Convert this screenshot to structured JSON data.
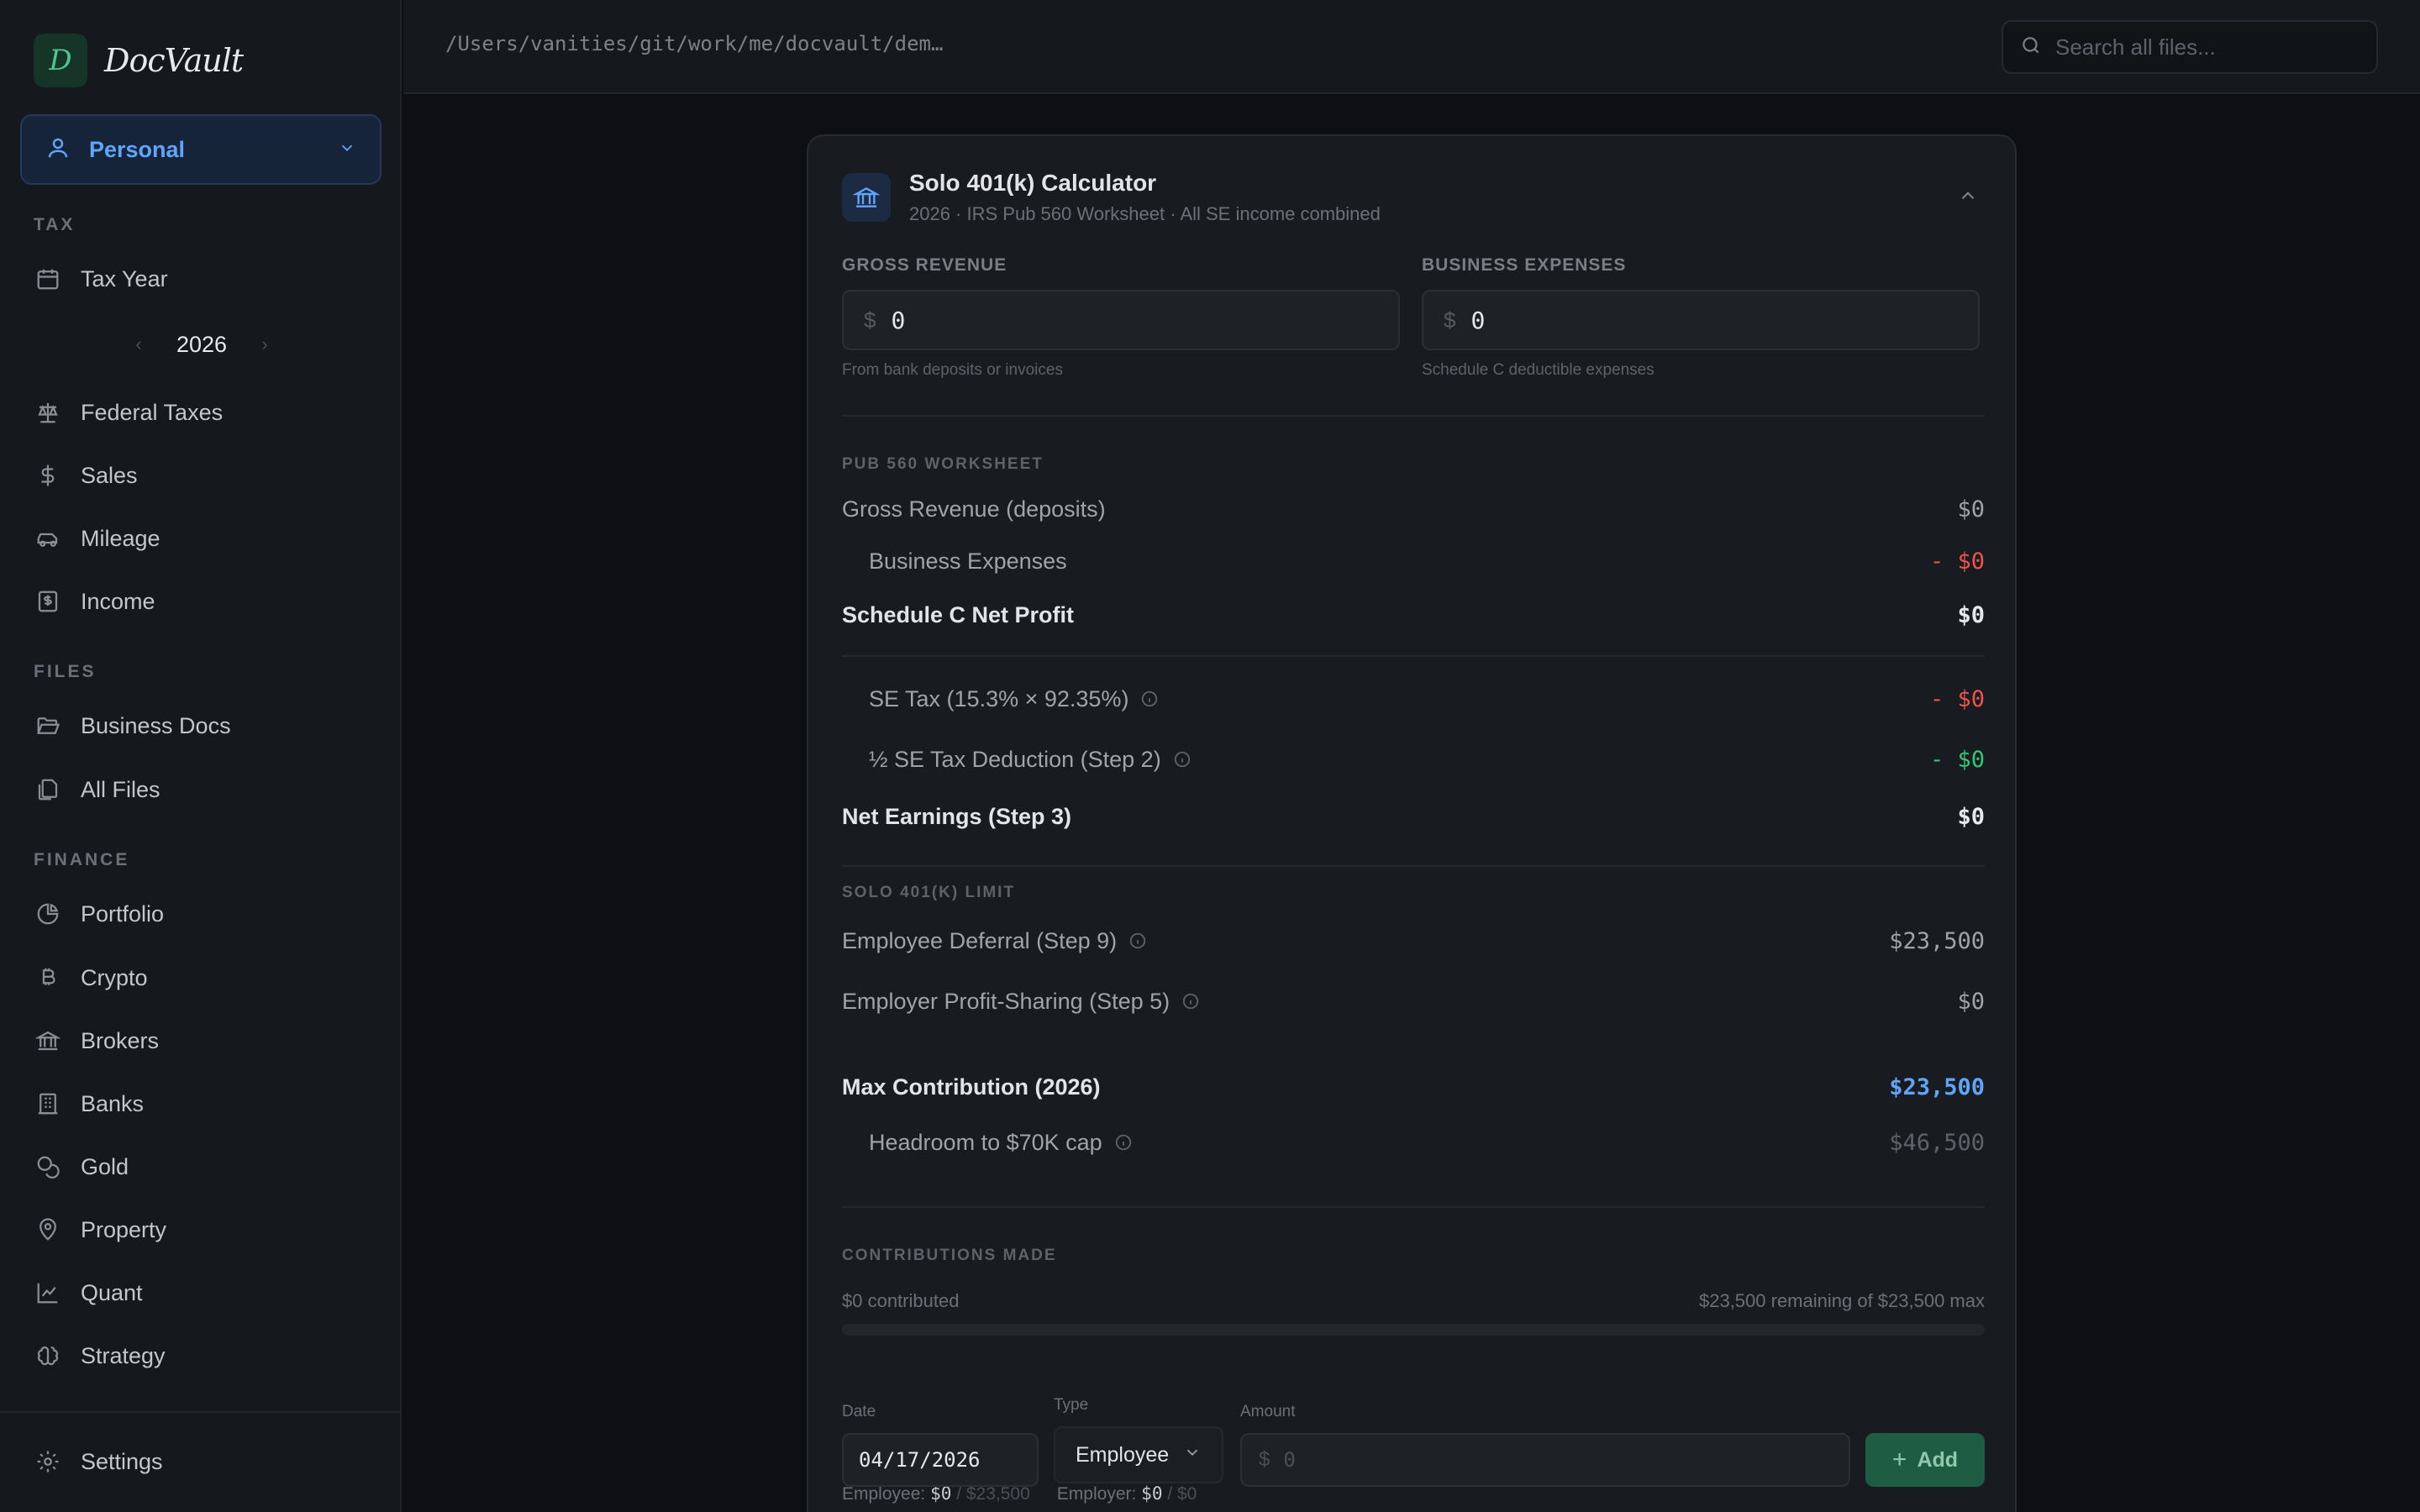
{
  "brand": {
    "logo_letter": "D",
    "name": "DocVault"
  },
  "profile": {
    "label": "Personal"
  },
  "sidebar": {
    "tax_title": "TAX",
    "tax_items": [
      {
        "label": "Tax Year",
        "icon": "calendar-icon"
      },
      {
        "label": "Federal Taxes",
        "icon": "scale-icon"
      },
      {
        "label": "Sales",
        "icon": "dollar-icon"
      },
      {
        "label": "Mileage",
        "icon": "car-icon"
      },
      {
        "label": "Income",
        "icon": "receipt-icon"
      }
    ],
    "year": "2026",
    "files_title": "FILES",
    "files_items": [
      {
        "label": "Business Docs",
        "icon": "folder-open-icon"
      },
      {
        "label": "All Files",
        "icon": "files-icon"
      }
    ],
    "finance_title": "FINANCE",
    "finance_items": [
      {
        "label": "Portfolio",
        "icon": "pie-chart-icon"
      },
      {
        "label": "Crypto",
        "icon": "bitcoin-icon"
      },
      {
        "label": "Brokers",
        "icon": "bank-icon"
      },
      {
        "label": "Banks",
        "icon": "building-icon"
      },
      {
        "label": "Gold",
        "icon": "coins-icon"
      },
      {
        "label": "Property",
        "icon": "map-pin-icon"
      },
      {
        "label": "Quant",
        "icon": "line-chart-icon"
      },
      {
        "label": "Strategy",
        "icon": "brain-icon"
      }
    ],
    "settings_label": "Settings"
  },
  "topbar": {
    "path": "/Users/vanities/git/work/me/docvault/dem…",
    "search_placeholder": "Search all files..."
  },
  "card": {
    "title": "Solo 401(k) Calculator",
    "subtitle": "2026 · IRS Pub 560 Worksheet · All SE income combined",
    "gross_revenue": {
      "label": "GROSS REVENUE",
      "currency": "$",
      "value": "0",
      "hint": "From bank deposits or invoices"
    },
    "business_expenses": {
      "label": "BUSINESS EXPENSES",
      "currency": "$",
      "value": "0",
      "hint": "Schedule C deductible expenses"
    },
    "worksheet": {
      "title": "PUB 560 WORKSHEET",
      "gross_revenue": {
        "label": "Gross Revenue (deposits)",
        "value": "$0"
      },
      "business_expenses": {
        "label": "Business Expenses",
        "value": "- $0"
      },
      "net_profit": {
        "label": "Schedule C Net Profit",
        "value": "$0"
      },
      "se_tax": {
        "label": "SE Tax (15.3% × 92.35%)",
        "value": "- $0"
      },
      "se_deduction": {
        "label": "½ SE Tax Deduction (Step 2)",
        "value": "- $0"
      },
      "net_earnings": {
        "label": "Net Earnings (Step 3)",
        "value": "$0"
      }
    },
    "limit": {
      "title": "SOLO 401(K) LIMIT",
      "employee_deferral": {
        "label": "Employee Deferral (Step 9)",
        "value": "$23,500"
      },
      "employer_profit": {
        "label": "Employer Profit-Sharing (Step 5)",
        "value": "$0"
      },
      "max_contribution": {
        "label": "Max Contribution (2026)",
        "value": "$23,500"
      },
      "headroom": {
        "label": "Headroom to $70K cap",
        "value": "$46,500"
      }
    },
    "contributions": {
      "title": "CONTRIBUTIONS MADE",
      "contributed": "$0 contributed",
      "remaining": "$23,500 remaining of $23,500 max",
      "progress_percent": 0,
      "employee_label": "Employee:",
      "employee_value": "$0",
      "employee_max": "/ $23,500",
      "employer_label": "Employer:",
      "employer_value": "$0",
      "employer_max": "/ $0",
      "date_label": "Date",
      "date_value": "04/17/2026",
      "type_label": "Type",
      "type_value": "Employee",
      "amount_label": "Amount",
      "amount_currency": "$",
      "amount_placeholder": "0",
      "add_label": "Add"
    }
  },
  "colors": {
    "accent_green": "#34c77b",
    "accent_blue": "#60a5fa",
    "negative_red": "#ef5350"
  }
}
